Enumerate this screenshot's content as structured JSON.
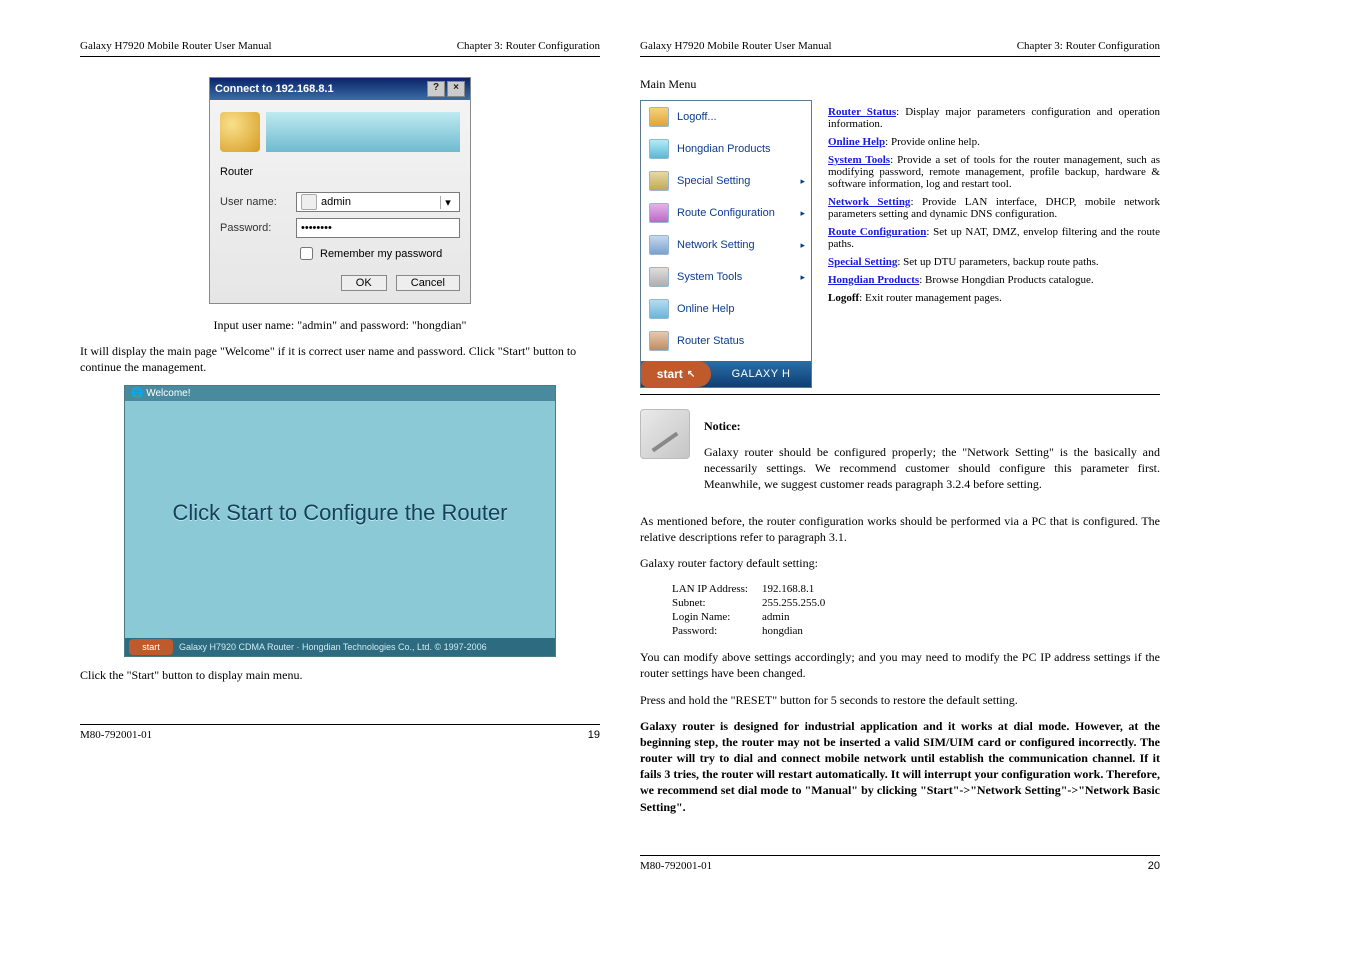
{
  "header": {
    "left": "Galaxy H7920 Mobile Router User Manual",
    "right": "Chapter 3: Router Configuration"
  },
  "footer": {
    "doc_no": "M80-792001-01",
    "p19": "19",
    "p20": "20"
  },
  "p19": {
    "dialog_title": "Connect to 192.168.8.1",
    "realm": "Router",
    "user_label": "User name:",
    "user_value": "admin",
    "pass_label": "Password:",
    "pass_value": "••••••••",
    "remember": "Remember my password",
    "ok": "OK",
    "cancel": "Cancel",
    "caption1": "Input user name: \"admin\" and password: \"hongdian\"",
    "para1": "It will display the main page \"Welcome\" if it is correct user name and password. Click \"Start\" button to continue the management.",
    "welcome_title": "Welcome!",
    "welcome_text": "Click Start to Configure the Router",
    "welcome_start": "start",
    "welcome_bar": "Galaxy H7920 CDMA Router · Hongdian Technologies Co., Ltd. © 1997-2006",
    "caption2": "Click the \"Start\" button to display main menu."
  },
  "p20": {
    "main_menu": "Main Menu",
    "menu": [
      "Logoff...",
      "Hongdian Products",
      "Special Setting",
      "Route Configuration",
      "Network Setting",
      "System Tools",
      "Online Help",
      "Router Status"
    ],
    "start_btn": "start",
    "start_bar": "GALAXY H",
    "desc": {
      "rs_t": "Router Status",
      "rs_d": ": Display major parameters configuration and operation information.",
      "oh_t": "Online Help",
      "oh_d": ": Provide online help.",
      "st_t": "System Tools",
      "st_d": ": Provide a set of tools for the router management, such as modifying password, remote management, profile backup, hardware & software information, log and restart tool.",
      "ns_t": "Network Setting",
      "ns_d": ": Provide LAN interface, DHCP, mobile network parameters setting and dynamic DNS configuration.",
      "rc_t": "Route Configuration",
      "rc_d": ": Set up NAT, DMZ, envelop filtering and the route paths.",
      "ss_t": "Special Setting",
      "ss_d": ": Set up DTU parameters, backup route paths.",
      "hp_t": "Hongdian Products",
      "hp_d": ": Browse Hongdian Products catalogue.",
      "lo_t": "Logoff",
      "lo_d": ": Exit router management pages."
    },
    "notice_h": "Notice:",
    "notice_p1": "Galaxy router should be configured properly; the \"Network Setting\" is the basically and necessarily settings. We recommend customer should configure this parameter first. Meanwhile, we suggest customer reads paragraph 3.2.4 before setting.",
    "p2": "As mentioned before, the router configuration works should be performed via a PC that is configured. The relative descriptions refer to paragraph 3.1.",
    "p3": "Galaxy router factory default setting:",
    "tbl": {
      "r1k": "LAN IP Address:",
      "r1v": "192.168.8.1",
      "r2k": "Subnet:",
      "r2v": "255.255.255.0",
      "r3k": "Login Name:",
      "r3v": "admin",
      "r4k": "Password:",
      "r4v": "hongdian"
    },
    "p4": "You can modify above settings accordingly; and you may need to modify the PC IP address settings if the router settings have been changed.",
    "p5": "Press and hold the \"RESET\" button for 5 seconds to restore the default setting.",
    "p6": "Galaxy router is designed for industrial application and it works at dial mode. However, at the beginning step, the router may not be inserted a valid SIM/UIM card or configured incorrectly. The router will try to dial and connect mobile network until establish the communication channel. If it fails 3 tries, the router will restart automatically. It will interrupt your configuration work. Therefore, we recommend set dial mode to \"Manual\" by clicking \"Start\"->\"Network Setting\"->\"Network Basic Setting\"."
  }
}
